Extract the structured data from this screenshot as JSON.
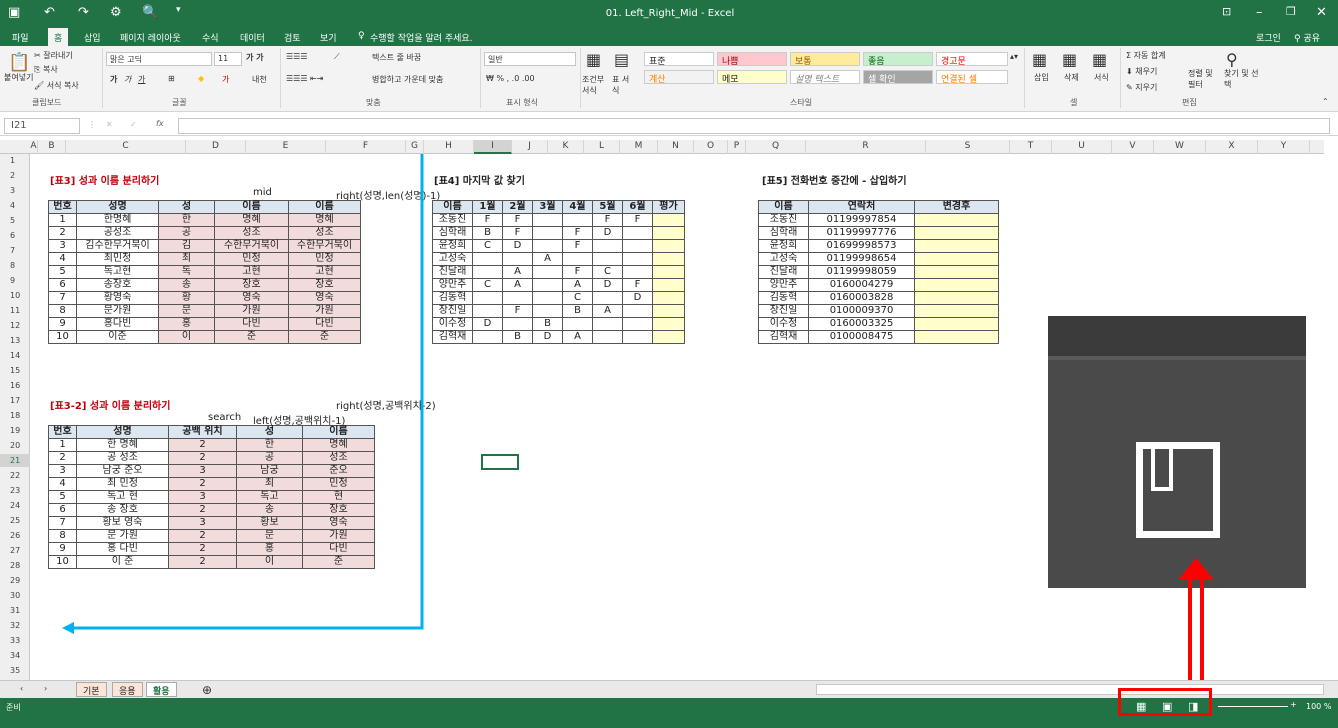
{
  "app": {
    "title": "01. Left_Right_Mid - Excel",
    "login": "로그인",
    "share": "공유"
  },
  "menu": [
    "파일",
    "홈",
    "삽입",
    "페이지 레이아웃",
    "수식",
    "데이터",
    "검토",
    "보기"
  ],
  "tell": "수행할 작업을 알려 주세요.",
  "ribbon": {
    "paste": "붙여넣기",
    "cut": "잘라내기",
    "copy": "복사",
    "format_painter": "서식 복사",
    "clipboard": "클립보드",
    "font_name": "맑은 고딕",
    "font_size": "11",
    "font_group": "글꼴",
    "wrap_text": "텍스트 줄 바꿈",
    "merge_center": "병합하고 가운데 맞춤",
    "align_group": "맞춤",
    "number_format": "일반",
    "number_group": "표시 형식",
    "conditional": "조건부 서식",
    "table_format": "표 서식",
    "styles": [
      {
        "label": "표준",
        "bg": "#ffffff",
        "fg": "#222222"
      },
      {
        "label": "나쁨",
        "bg": "#ffc7ce",
        "fg": "#9c0006"
      },
      {
        "label": "보통",
        "bg": "#ffeb9c",
        "fg": "#9c5700"
      },
      {
        "label": "좋음",
        "bg": "#c6efce",
        "fg": "#006100"
      },
      {
        "label": "경고문",
        "bg": "#ffffff",
        "fg": "#ff0000"
      },
      {
        "label": "계산",
        "bg": "#f2f2f2",
        "fg": "#fa7d00"
      },
      {
        "label": "메모",
        "bg": "#ffffcc",
        "fg": "#222222"
      },
      {
        "label": "설명 텍스트",
        "bg": "#ffffff",
        "fg": "#7f7f7f"
      },
      {
        "label": "셀 확인",
        "bg": "#a5a5a5",
        "fg": "#ffffff"
      },
      {
        "label": "연결된 셀",
        "bg": "#ffffff",
        "fg": "#fa7d00"
      }
    ],
    "style_group": "스타일",
    "insert": "삽입",
    "delete": "삭제",
    "format": "서식",
    "cells_group": "셀",
    "autosum": "자동 합계",
    "fill": "채우기",
    "clear": "지우기",
    "sort_filter": "정렬 및 필터",
    "find_select": "찾기 및 선택",
    "edit_group": "편집"
  },
  "namebox": "I21",
  "columns": [
    "A",
    "B",
    "C",
    "D",
    "E",
    "F",
    "G",
    "H",
    "I",
    "J",
    "K",
    "L",
    "M",
    "N",
    "O",
    "P",
    "Q",
    "R",
    "S",
    "T",
    "U",
    "V",
    "W",
    "X",
    "Y"
  ],
  "t3": {
    "title": "[표3] 성과 이름 분리하기",
    "note_mid": "mid",
    "note_right": "right(성명,len(성명)-1)",
    "headers": [
      "번호",
      "성명",
      "성",
      "이름",
      "이름"
    ],
    "rows": [
      [
        "1",
        "한명혜",
        "한",
        "명혜",
        "명혜"
      ],
      [
        "2",
        "공성조",
        "공",
        "성조",
        "성조"
      ],
      [
        "3",
        "김수한무거북이",
        "김",
        "수한무거북이",
        "수한무거북이"
      ],
      [
        "4",
        "최민정",
        "최",
        "민정",
        "민정"
      ],
      [
        "5",
        "독고현",
        "독",
        "고현",
        "고현"
      ],
      [
        "6",
        "송장호",
        "송",
        "장호",
        "장호"
      ],
      [
        "7",
        "황영숙",
        "황",
        "영숙",
        "영숙"
      ],
      [
        "8",
        "문가원",
        "문",
        "가원",
        "가원"
      ],
      [
        "9",
        "홍다빈",
        "홍",
        "다빈",
        "다빈"
      ],
      [
        "10",
        "이준",
        "이",
        "준",
        "준"
      ]
    ]
  },
  "t32": {
    "title": "[표3-2] 성과 이름 분리하기",
    "note_search": "search",
    "note_left": "left(성명,공백위치-1)",
    "note_right": "right(성명,공백위치-2)",
    "headers": [
      "번호",
      "성명",
      "공백 위치",
      "성",
      "이름"
    ],
    "rows": [
      [
        "1",
        "한 명혜",
        "2",
        "한",
        "명혜"
      ],
      [
        "2",
        "공 성조",
        "2",
        "공",
        "성조"
      ],
      [
        "3",
        "남궁 준오",
        "3",
        "남궁",
        "준오"
      ],
      [
        "4",
        "최 민정",
        "2",
        "최",
        "민정"
      ],
      [
        "5",
        "독고 현",
        "3",
        "독고",
        "현"
      ],
      [
        "6",
        "송 장호",
        "2",
        "송",
        "장호"
      ],
      [
        "7",
        "황보 영숙",
        "3",
        "황보",
        "영숙"
      ],
      [
        "8",
        "문 가원",
        "2",
        "문",
        "가원"
      ],
      [
        "9",
        "홍 다빈",
        "2",
        "홍",
        "다빈"
      ],
      [
        "10",
        "이 준",
        "2",
        "이",
        "준"
      ]
    ]
  },
  "t4": {
    "title": "[표4] 마지막 값 찾기",
    "headers": [
      "이름",
      "1월",
      "2월",
      "3월",
      "4월",
      "5월",
      "6월",
      "평가"
    ],
    "rows": [
      [
        "조동진",
        "F",
        "F",
        "",
        "",
        "F",
        "F",
        ""
      ],
      [
        "심학래",
        "B",
        "F",
        "",
        "F",
        "D",
        "",
        ""
      ],
      [
        "윤정희",
        "C",
        "D",
        "",
        "F",
        "",
        "",
        ""
      ],
      [
        "고성숙",
        "",
        "",
        "A",
        "",
        "",
        "",
        ""
      ],
      [
        "진달래",
        "",
        "A",
        "",
        "F",
        "C",
        "",
        ""
      ],
      [
        "양만추",
        "C",
        "A",
        "",
        "A",
        "D",
        "F",
        ""
      ],
      [
        "김동혁",
        "",
        "",
        "",
        "C",
        "",
        "D",
        ""
      ],
      [
        "장진일",
        "",
        "F",
        "",
        "B",
        "A",
        "",
        ""
      ],
      [
        "이수정",
        "D",
        "",
        "B",
        "",
        "",
        "",
        ""
      ],
      [
        "김혁재",
        "",
        "B",
        "D",
        "A",
        "",
        "",
        ""
      ]
    ]
  },
  "t5": {
    "title": "[표5] 전화번호 중간에 - 삽입하기",
    "headers": [
      "이름",
      "연락처",
      "변경후"
    ],
    "rows": [
      [
        "조동진",
        "01199997854",
        ""
      ],
      [
        "심학래",
        "01199997776",
        ""
      ],
      [
        "윤정희",
        "01699998573",
        ""
      ],
      [
        "고성숙",
        "01199998654",
        ""
      ],
      [
        "진달래",
        "01199998059",
        ""
      ],
      [
        "양만추",
        "0160004279",
        ""
      ],
      [
        "김동혁",
        "0160003828",
        ""
      ],
      [
        "장진일",
        "0100009370",
        ""
      ],
      [
        "이수정",
        "0160003325",
        ""
      ],
      [
        "김혁재",
        "0100008475",
        ""
      ]
    ]
  },
  "sheets": [
    "기본",
    "응용",
    "활용"
  ],
  "status": {
    "ready": "준비",
    "zoom": "100 %"
  }
}
